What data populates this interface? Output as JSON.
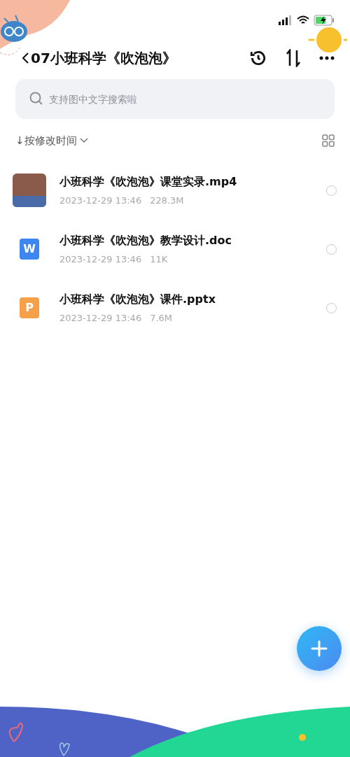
{
  "nav": {
    "title": "07小班科学《吹泡泡》"
  },
  "search": {
    "placeholder": "支持图中文字搜索啦"
  },
  "sort": {
    "label": "↓按修改时间"
  },
  "files": [
    {
      "kind": "video",
      "name": "小班科学《吹泡泡》课堂实录.mp4",
      "date": "2023-12-29 13:46",
      "size": "228.3M",
      "selected": false
    },
    {
      "kind": "word",
      "icon_letter": "W",
      "name": "小班科学《吹泡泡》教学设计.doc",
      "date": "2023-12-29 13:46",
      "size": "11K",
      "selected": false
    },
    {
      "kind": "ppt",
      "icon_letter": "P",
      "name": "小班科学《吹泡泡》课件.pptx",
      "date": "2023-12-29 13:46",
      "size": "7.6M",
      "selected": false
    }
  ]
}
